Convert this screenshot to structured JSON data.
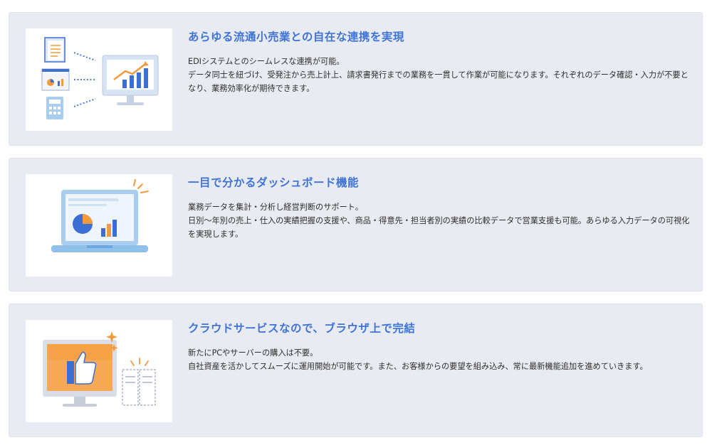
{
  "features": [
    {
      "title": "あらゆる流通小売業との自在な連携を実現",
      "lead": "EDIシステムとのシームレスな連携が可能。",
      "body": "データ同士を紐づけ、受発注から売上計上、請求書発行までの業務を一貫して作業が可能になります。それぞれのデータ確認・入力が不要となり、業務効率化が期待できます。",
      "icons": [
        "document-icon",
        "invoice-icon",
        "calculator-icon",
        "monitor-chart-icon"
      ]
    },
    {
      "title": "一目で分かるダッシュボード機能",
      "lead": "業務データを集計・分析し経営判断のサポート。",
      "body": "日別〜年別の売上・仕入の実績把握の支援や、商品・得意先・担当者別の実績の比較データで営業支援も可能。あらゆる入力データの可視化を実現します。",
      "icons": [
        "laptop-dashboard-icon"
      ]
    },
    {
      "title": "クラウドサービスなので、ブラウザ上で完結",
      "lead": "新たにPCやサーバーの購入は不要。",
      "body": "自社資産を活かしてスムーズに運用開始が可能です。また、お客様からの要望を組み込み、常に最新機能追加を進めていきます。",
      "icons": [
        "monitor-thumbs-up-icon",
        "server-icon"
      ]
    }
  ],
  "colors": {
    "title": "#3f73d8",
    "card_bg": "#e9ebf2",
    "accent_orange": "#f39a3c",
    "accent_blue": "#3b6fd4"
  }
}
